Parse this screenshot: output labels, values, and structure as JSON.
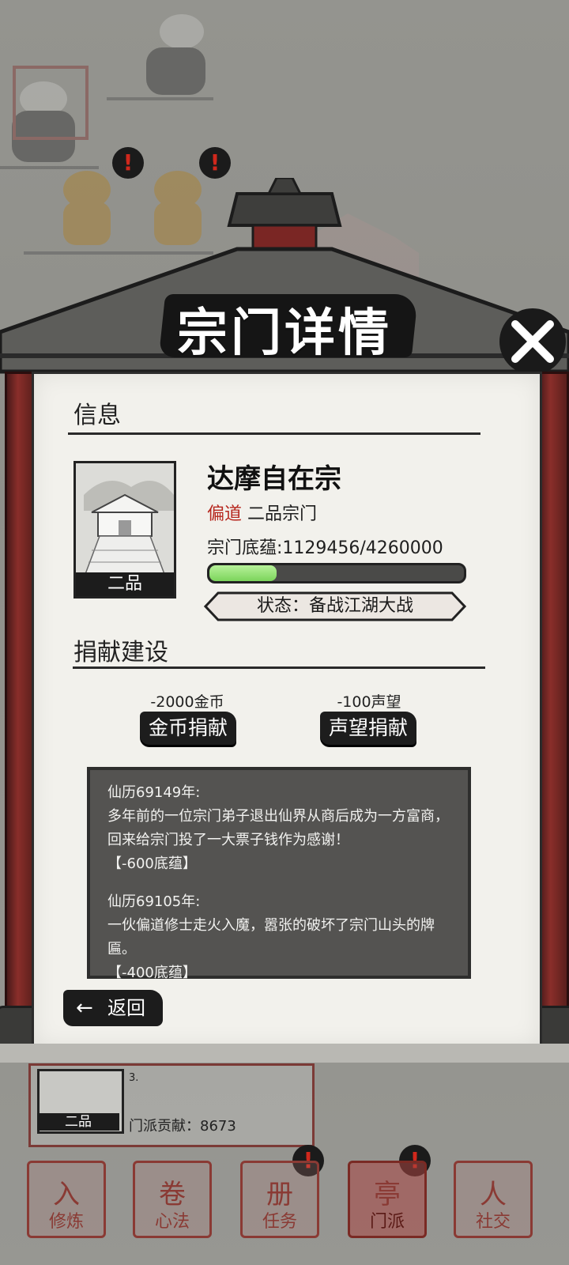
{
  "dialog": {
    "title": "宗门详情",
    "info_heading": "信息",
    "sect_name": "达摩自在宗",
    "alignment": "偏道",
    "rank_label": "二品宗门",
    "thumb_caption": "二品",
    "foundation_text": "宗门底蕴:1129456/4260000",
    "foundation_progress": 0.265,
    "status_text": "状态：备战江湖大战",
    "donate_heading": "捐献建设",
    "gold_cost": "-2000金币",
    "gold_button": "金币捐献",
    "fame_cost": "-100声望",
    "fame_button": "声望捐献",
    "log": [
      {
        "year": "仙历69149年:",
        "text": "多年前的一位宗门弟子退出仙界从商后成为一方富商，回来给宗门投了一大票子钱作为感谢！",
        "effect": "【-600底蕴】"
      },
      {
        "year": "仙历69105年:",
        "text": "一伙偏道修士走火入魔，嚣张的破坏了宗门山头的牌匾。",
        "effect": "【-400底蕴】"
      }
    ],
    "back_button": "返回"
  },
  "background_card": {
    "caption": "二品",
    "line3": "3.",
    "contribution": "门派贡献：8673"
  },
  "bottom_nav": [
    {
      "label": "修炼",
      "glyph": "入",
      "active": false
    },
    {
      "label": "心法",
      "glyph": "卷",
      "active": false
    },
    {
      "label": "任务",
      "glyph": "册",
      "active": false
    },
    {
      "label": "门派",
      "glyph": "亭",
      "active": true
    },
    {
      "label": "社交",
      "glyph": "人",
      "active": false
    }
  ],
  "colors": {
    "accent_red": "#b6271e",
    "progress_green": "#7bd45b",
    "frame_red": "#8a2e2a"
  },
  "icons": {
    "close": "close-x-icon",
    "back": "arrow-left-icon",
    "alert": "exclamation-badge-icon"
  }
}
